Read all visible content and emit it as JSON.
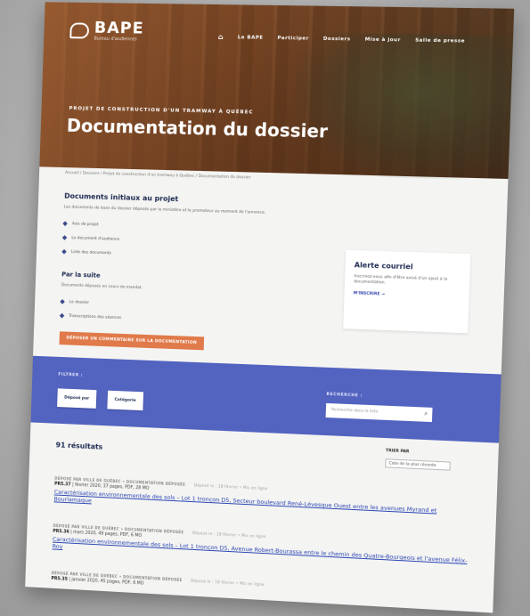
{
  "brand": {
    "name": "BAPE",
    "tagline": "Bureau d'audiences"
  },
  "nav": {
    "items": [
      "Le BAPE",
      "Participer",
      "Dossiers",
      "Mise à jour",
      "Salle de presse"
    ]
  },
  "hero": {
    "kicker": "PROJET DE CONSTRUCTION D'UN TRAMWAY À QUÉBEC",
    "title": "Documentation du dossier"
  },
  "breadcrumb": "Accueil  /  Dossiers  /  Projet de construction d'un tramway à Québec  /  Documentation du dossier",
  "initial_docs": {
    "heading": "Documents initiaux au projet",
    "description": "Les documents de base du dossier déposés par le ministère et le promoteur au moment de l'annonce.",
    "links": [
      "Avis de projet",
      "Le document d'audience",
      "Liste des documents"
    ]
  },
  "follow_up": {
    "heading": "Par la suite",
    "description": "Documents déposés en cours de mandat.",
    "links": [
      "Le dossier",
      "Transcriptions des séances"
    ],
    "button": "DÉPOSER UN COMMENTAIRE SUR LA DOCUMENTATION"
  },
  "alert": {
    "title": "Alerte courriel",
    "description": "Inscrivez-vous afin d'être avisé d'un ajout à la documentation.",
    "link": "M'INSCRIRE  →"
  },
  "filter": {
    "label": "FILTRER :",
    "buttons": [
      "Déposé par",
      "Catégorie"
    ],
    "search_label": "RECHERCHE :",
    "search_placeholder": "Recherche dans la liste"
  },
  "results": {
    "count_text": "91 résultats",
    "sort_label": "TRIER PAR",
    "sort_value": "Cote de la plus récente",
    "items": [
      {
        "meta": "DÉPOSÉ PAR VILLE DE QUÉBEC  •  DOCUMENTATION DÉPOSÉE",
        "date": "Déposé le : 18 février  •  Mis en ligne",
        "code": "PR5.37",
        "info": "  |  février 2020, 37 pages, PDF, 28 MO",
        "title": "Caractérisation environnementale des sols – Lot 1 tronçon D5, Secteur boulevard René-Lévesque Ouest entre les avenues Myrand et Bourlamaque"
      },
      {
        "meta": "DÉPOSÉ PAR VILLE DE QUÉBEC  •  DOCUMENTATION DÉPOSÉE",
        "date": "Déposé le : 18 février  •  Mis en ligne",
        "code": "PR5.36",
        "info": "  |  mars 2020, 49 pages, PDF, 6 MO",
        "title": "Caractérisation environnementale des sols – Lot 1 tronçon D5, Avenue Robert-Bourassa entre le chemin des Quatre-Bourgeois et l'avenue Félix-Roy"
      },
      {
        "meta": "DÉPOSÉ PAR VILLE DE QUÉBEC  •  DOCUMENTATION DÉPOSÉE",
        "date": "Déposé le : 18 février  •  Mis en ligne",
        "code": "PR5.35",
        "info": "  |  janvier 2020, 45 pages, PDF, 6 MO",
        "title": ""
      }
    ]
  }
}
